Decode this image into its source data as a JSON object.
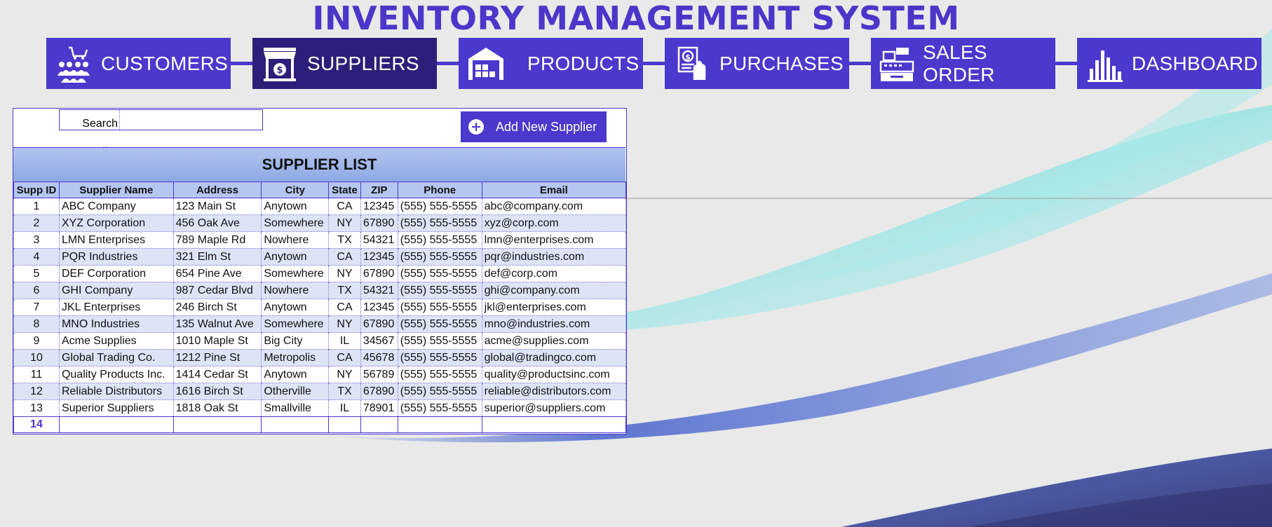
{
  "app": {
    "title": "INVENTORY MANAGEMENT SYSTEM"
  },
  "nav": [
    {
      "label": "CUSTOMERS",
      "icon": "customers-cart-icon",
      "active": false
    },
    {
      "label": "SUPPLIERS",
      "icon": "supplier-store-icon",
      "active": true
    },
    {
      "label": "PRODUCTS",
      "icon": "warehouse-icon",
      "active": false
    },
    {
      "label": "PURCHASES",
      "icon": "purchase-invoice-icon",
      "active": false
    },
    {
      "label": "SALES ORDER",
      "icon": "cash-register-icon",
      "active": false
    },
    {
      "label": "DASHBOARD",
      "icon": "bar-chart-icon",
      "active": false
    }
  ],
  "search": {
    "label": "Search Supplier",
    "value": ""
  },
  "add_button": {
    "label": "Add New Supplier",
    "icon": "plus-circle-icon"
  },
  "list": {
    "title": "SUPPLIER LIST",
    "columns": [
      "Supp ID",
      "Supplier Name",
      "Address",
      "City",
      "State",
      "ZIP",
      "Phone",
      "Email"
    ],
    "rows": [
      [
        "1",
        "ABC Company",
        "123 Main St",
        "Anytown",
        "CA",
        "12345",
        "(555) 555-5555",
        "abc@company.com"
      ],
      [
        "2",
        "XYZ Corporation",
        "456 Oak Ave",
        "Somewhere",
        "NY",
        "67890",
        "(555) 555-5555",
        "xyz@corp.com"
      ],
      [
        "3",
        "LMN Enterprises",
        "789 Maple Rd",
        "Nowhere",
        "TX",
        "54321",
        "(555) 555-5555",
        "lmn@enterprises.com"
      ],
      [
        "4",
        "PQR Industries",
        "321 Elm St",
        "Anytown",
        "CA",
        "12345",
        "(555) 555-5555",
        "pqr@industries.com"
      ],
      [
        "5",
        "DEF Corporation",
        "654 Pine Ave",
        "Somewhere",
        "NY",
        "67890",
        "(555) 555-5555",
        "def@corp.com"
      ],
      [
        "6",
        "GHI Company",
        "987 Cedar Blvd",
        "Nowhere",
        "TX",
        "54321",
        "(555) 555-5555",
        "ghi@company.com"
      ],
      [
        "7",
        "JKL Enterprises",
        "246 Birch St",
        "Anytown",
        "CA",
        "12345",
        "(555) 555-5555",
        "jkl@enterprises.com"
      ],
      [
        "8",
        "MNO Industries",
        "135 Walnut Ave",
        "Somewhere",
        "NY",
        "67890",
        "(555) 555-5555",
        "mno@industries.com"
      ],
      [
        "9",
        "Acme Supplies",
        "1010 Maple St",
        "Big City",
        "IL",
        "34567",
        "(555) 555-5555",
        "acme@supplies.com"
      ],
      [
        "10",
        "Global Trading Co.",
        "1212 Pine St",
        "Metropolis",
        "CA",
        "45678",
        "(555) 555-5555",
        "global@tradingco.com"
      ],
      [
        "11",
        "Quality Products Inc.",
        "1414 Cedar St",
        "Anytown",
        "NY",
        "56789",
        "(555) 555-5555",
        "quality@productsinc.com"
      ],
      [
        "12",
        "Reliable Distributors",
        "1616 Birch St",
        "Otherville",
        "TX",
        "67890",
        "(555) 555-5555",
        "reliable@distributors.com"
      ],
      [
        "13",
        "Superior Suppliers",
        "1818 Oak St",
        "Smallville",
        "IL",
        "78901",
        "(555) 555-5555",
        "superior@suppliers.com"
      ]
    ],
    "new_row_id": "14"
  },
  "colors": {
    "accent": "#4b38cc",
    "active_nav": "#2c1f79",
    "title": "#4b36c9",
    "header_band": "#b2c5ef",
    "row_alt": "#dce4f6"
  }
}
